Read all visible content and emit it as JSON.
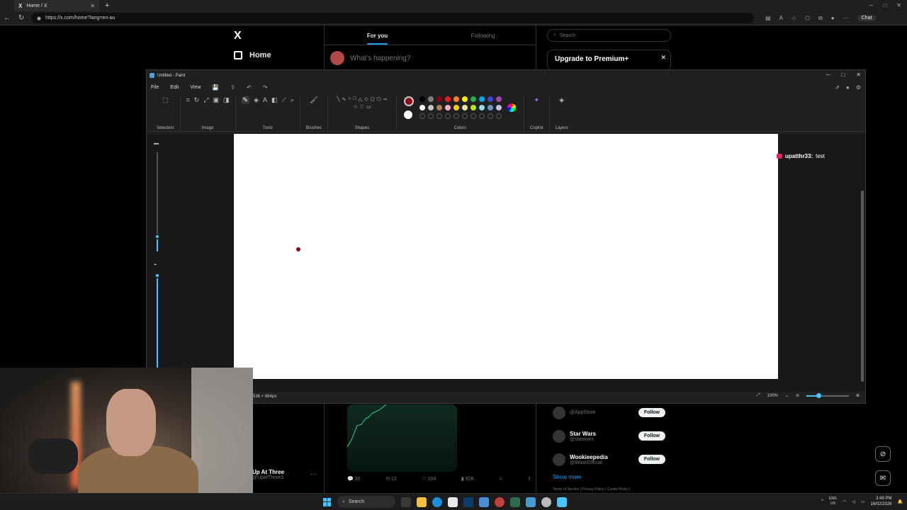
{
  "browser": {
    "tab_title": "Home / X",
    "url": "https://x.com/home?lang=en-au",
    "chat_label": "Chat"
  },
  "x": {
    "logo": "X",
    "nav_home": "Home",
    "tabs": [
      "For you",
      "Following"
    ],
    "compose_placeholder": "What's happening?",
    "search_placeholder": "Search",
    "premium_title": "Upgrade to Premium+",
    "tweet_author_name": "Up At Three",
    "tweet_author_handle": "@UpatThree3",
    "tweet_stats": {
      "replies": "30",
      "reposts": "12",
      "likes": "104",
      "views": "92K"
    },
    "who_to_follow": [
      {
        "name": "",
        "handle": "@AppStore",
        "button": "Follow"
      },
      {
        "name": "Star Wars",
        "handle": "@starwars",
        "button": "Follow"
      },
      {
        "name": "Wookieepedia",
        "handle": "@WookOfficial",
        "button": "Follow"
      }
    ],
    "show_more": "Show more",
    "footer": "Terms of Service  |  Privacy Policy  |  Cookie Policy  |"
  },
  "paint": {
    "title": "Untitled - Paint",
    "menu": [
      "File",
      "Edit",
      "View"
    ],
    "groups": {
      "selection": "Selection",
      "image": "Image",
      "tools": "Tools",
      "brushes": "Brushes",
      "shapes": "Shapes",
      "colors": "Colors",
      "copilot": "Copilot",
      "layers": "Layers"
    },
    "canvas_size": "536 × 864px",
    "zoom": "100%",
    "current_color": "#8b0a1a",
    "palette": [
      "#000000",
      "#7f7f7f",
      "#880015",
      "#ed1c24",
      "#ff7f27",
      "#fff200",
      "#22b14c",
      "#00a2e8",
      "#3f48cc",
      "#a349a4",
      "#ffffff",
      "#c3c3c3",
      "#b97a57",
      "#ffaec9",
      "#ffc90e",
      "#efe4b0",
      "#b5e61d",
      "#99d9ea",
      "#7092be",
      "#c8bfe7"
    ]
  },
  "overlay": {
    "chat_user": "upatthr33:",
    "chat_msg": "test"
  },
  "taskbar": {
    "search": "Search",
    "lang_line1": "ENG",
    "lang_line2": "US",
    "time": "3:49 PM",
    "date": "16/02/2026"
  }
}
